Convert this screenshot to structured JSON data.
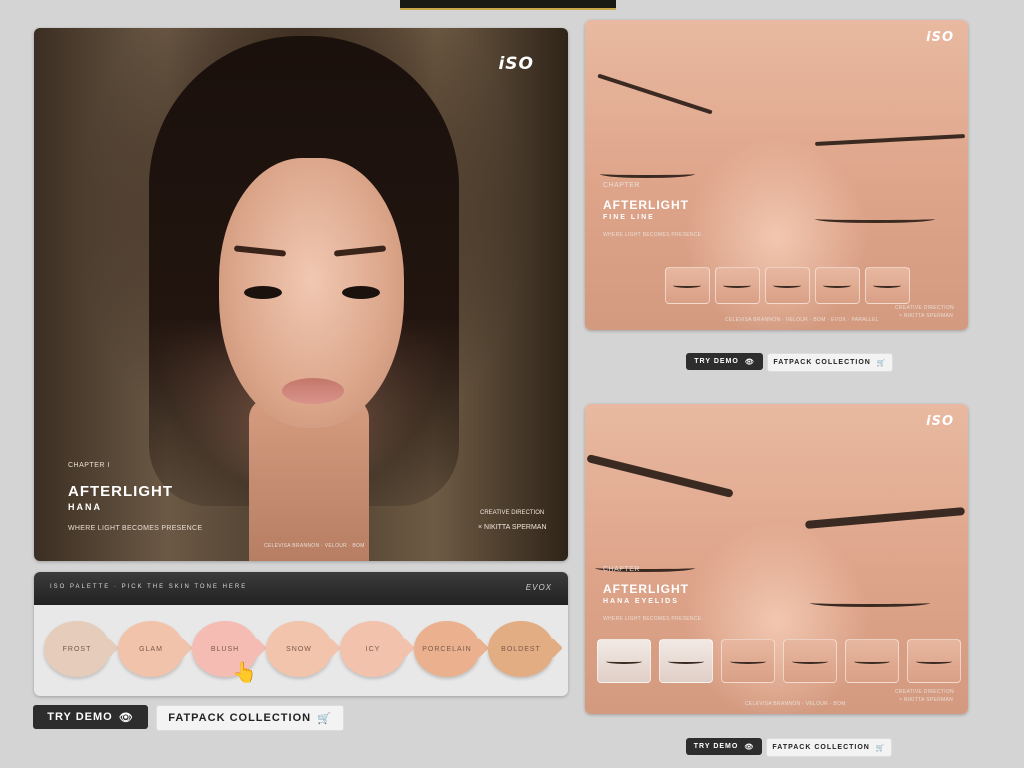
{
  "main_ad": {
    "logo": "iSO",
    "chapter": "CHAPTER I",
    "title": "AFTERLIGHT",
    "subtitle": "HANA",
    "tagline": "WHERE LIGHT BECOMES PRESENCE",
    "credit_label": "CREATIVE DIRECTION",
    "credit_name": "× NIKITTA SPERMAN",
    "footnote": "CELEVISA BRANNON · VELOUR · BOM"
  },
  "palette": {
    "title": "ISO PALETTE · PICK THE SKIN TONE HERE",
    "brand": "EVOX",
    "swatches": [
      {
        "label": "FROST",
        "color": "#e6cdbb"
      },
      {
        "label": "GLAM",
        "color": "#f1c3ab"
      },
      {
        "label": "BLUSH",
        "color": "#f5bcb4"
      },
      {
        "label": "SNOW",
        "color": "#f2c4ab"
      },
      {
        "label": "ICY",
        "color": "#f3c2ac"
      },
      {
        "label": "PORCELAIN",
        "color": "#ebb18e"
      },
      {
        "label": "BOLDEST",
        "color": "#e3ad84"
      }
    ]
  },
  "main_buttons": {
    "try_demo": "TRY DEMO",
    "fatpack": "FATPACK COLLECTION"
  },
  "ad_fine_line": {
    "logo": "iSO",
    "chapter": "CHAPTER",
    "title": "AFTERLIGHT",
    "subtitle": "FINE LINE",
    "tagline": "WHERE LIGHT BECOMES PRESENCE",
    "credit_label": "CREATIVE DIRECTION",
    "credit_name": "× NIKITTA SPERMAN",
    "footnote": "CELEVISA BRANNON · VELOUR · BOM · EVOX · PARALLEL",
    "try_demo": "TRY DEMO",
    "fatpack": "FATPACK COLLECTION"
  },
  "ad_eyelids": {
    "logo": "iSO",
    "chapter": "CHAPTER",
    "title": "AFTERLIGHT",
    "subtitle": "HANA EYELIDS",
    "tagline": "WHERE LIGHT BECOMES PRESENCE",
    "credit_label": "CREATIVE DIRECTION",
    "credit_name": "× NIKITTA SPERMAN",
    "footnote": "CELEVISA BRANNON · VELOUR · BOM",
    "try_demo": "TRY DEMO",
    "fatpack": "FATPACK COLLECTION"
  },
  "icons": {
    "demo": "eye-icon",
    "cart": "cart-icon",
    "pointer": "hand-pointer-icon"
  }
}
